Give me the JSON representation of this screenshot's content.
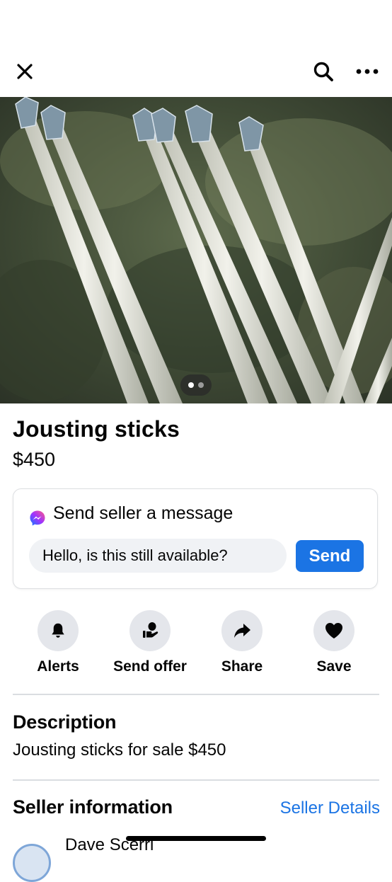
{
  "header": {
    "close_icon": "close-icon",
    "search_icon": "search-icon",
    "more_icon": "more-horizontal-icon"
  },
  "photo": {
    "pager_total": 2,
    "pager_active": 1
  },
  "listing": {
    "title": "Jousting sticks",
    "price": "$450"
  },
  "message": {
    "heading": "Send seller a message",
    "input_value": "Hello, is this still available?",
    "send_label": "Send",
    "icon": "messenger-icon"
  },
  "actions": [
    {
      "label": "Alerts",
      "icon": "bell-icon"
    },
    {
      "label": "Send offer",
      "icon": "offer-hand-icon"
    },
    {
      "label": "Share",
      "icon": "share-arrow-icon"
    },
    {
      "label": "Save",
      "icon": "heart-icon"
    }
  ],
  "description": {
    "heading": "Description",
    "text": "Jousting sticks for sale $450"
  },
  "seller": {
    "heading": "Seller information",
    "details_link": "Seller Details",
    "name": "Dave Scerri"
  },
  "colors": {
    "accent": "#1b74e4",
    "chip_bg": "#e4e6eb",
    "input_bg": "#f0f2f5",
    "divider": "#dadde1"
  }
}
